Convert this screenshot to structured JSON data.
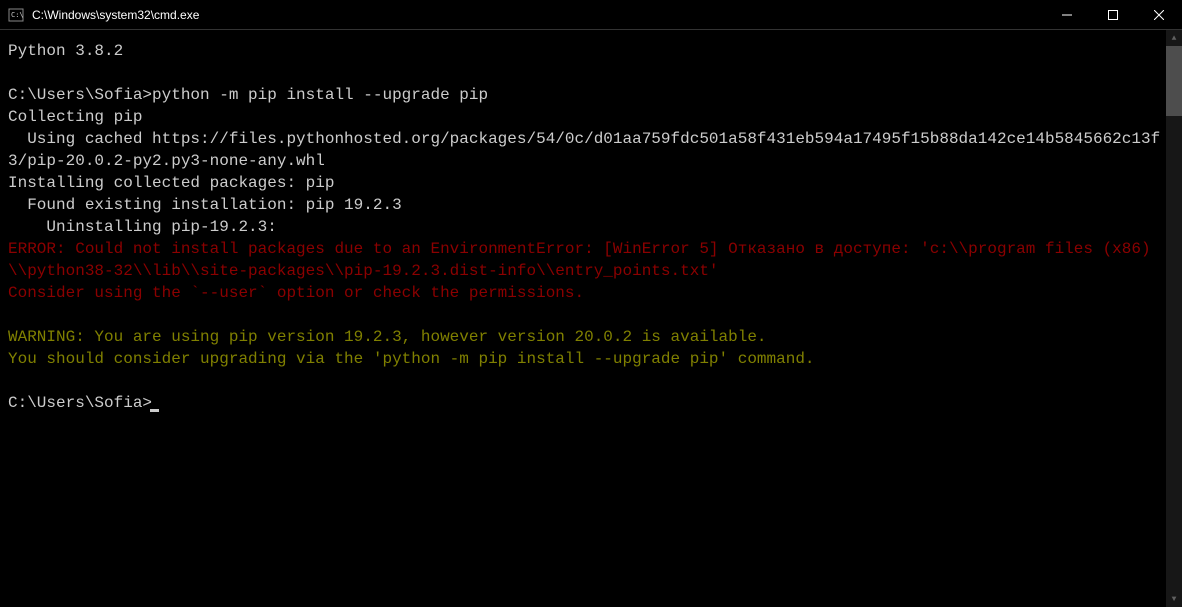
{
  "window": {
    "title": "C:\\Windows\\system32\\cmd.exe"
  },
  "terminal": {
    "lines": [
      {
        "text": "Python 3.8.2",
        "class": ""
      },
      {
        "text": "",
        "class": "blank"
      },
      {
        "text": "C:\\Users\\Sofia>python -m pip install --upgrade pip",
        "class": ""
      },
      {
        "text": "Collecting pip",
        "class": ""
      },
      {
        "text": "  Using cached https://files.pythonhosted.org/packages/54/0c/d01aa759fdc501a58f431eb594a17495f15b88da142ce14b5845662c13f3/pip-20.0.2-py2.py3-none-any.whl",
        "class": ""
      },
      {
        "text": "Installing collected packages: pip",
        "class": ""
      },
      {
        "text": "  Found existing installation: pip 19.2.3",
        "class": ""
      },
      {
        "text": "    Uninstalling pip-19.2.3:",
        "class": ""
      },
      {
        "text": "ERROR: Could not install packages due to an EnvironmentError: [WinError 5] Отказано в доступе: 'c:\\\\program files (x86)\\\\python38-32\\\\lib\\\\site-packages\\\\pip-19.2.3.dist-info\\\\entry_points.txt'",
        "class": "error"
      },
      {
        "text": "Consider using the `--user` option or check the permissions.",
        "class": "error"
      },
      {
        "text": "",
        "class": "blank"
      },
      {
        "text": "WARNING: You are using pip version 19.2.3, however version 20.0.2 is available.",
        "class": "warning"
      },
      {
        "text": "You should consider upgrading via the 'python -m pip install --upgrade pip' command.",
        "class": "warning"
      },
      {
        "text": "",
        "class": "blank"
      }
    ],
    "prompt": "C:\\Users\\Sofia>"
  }
}
